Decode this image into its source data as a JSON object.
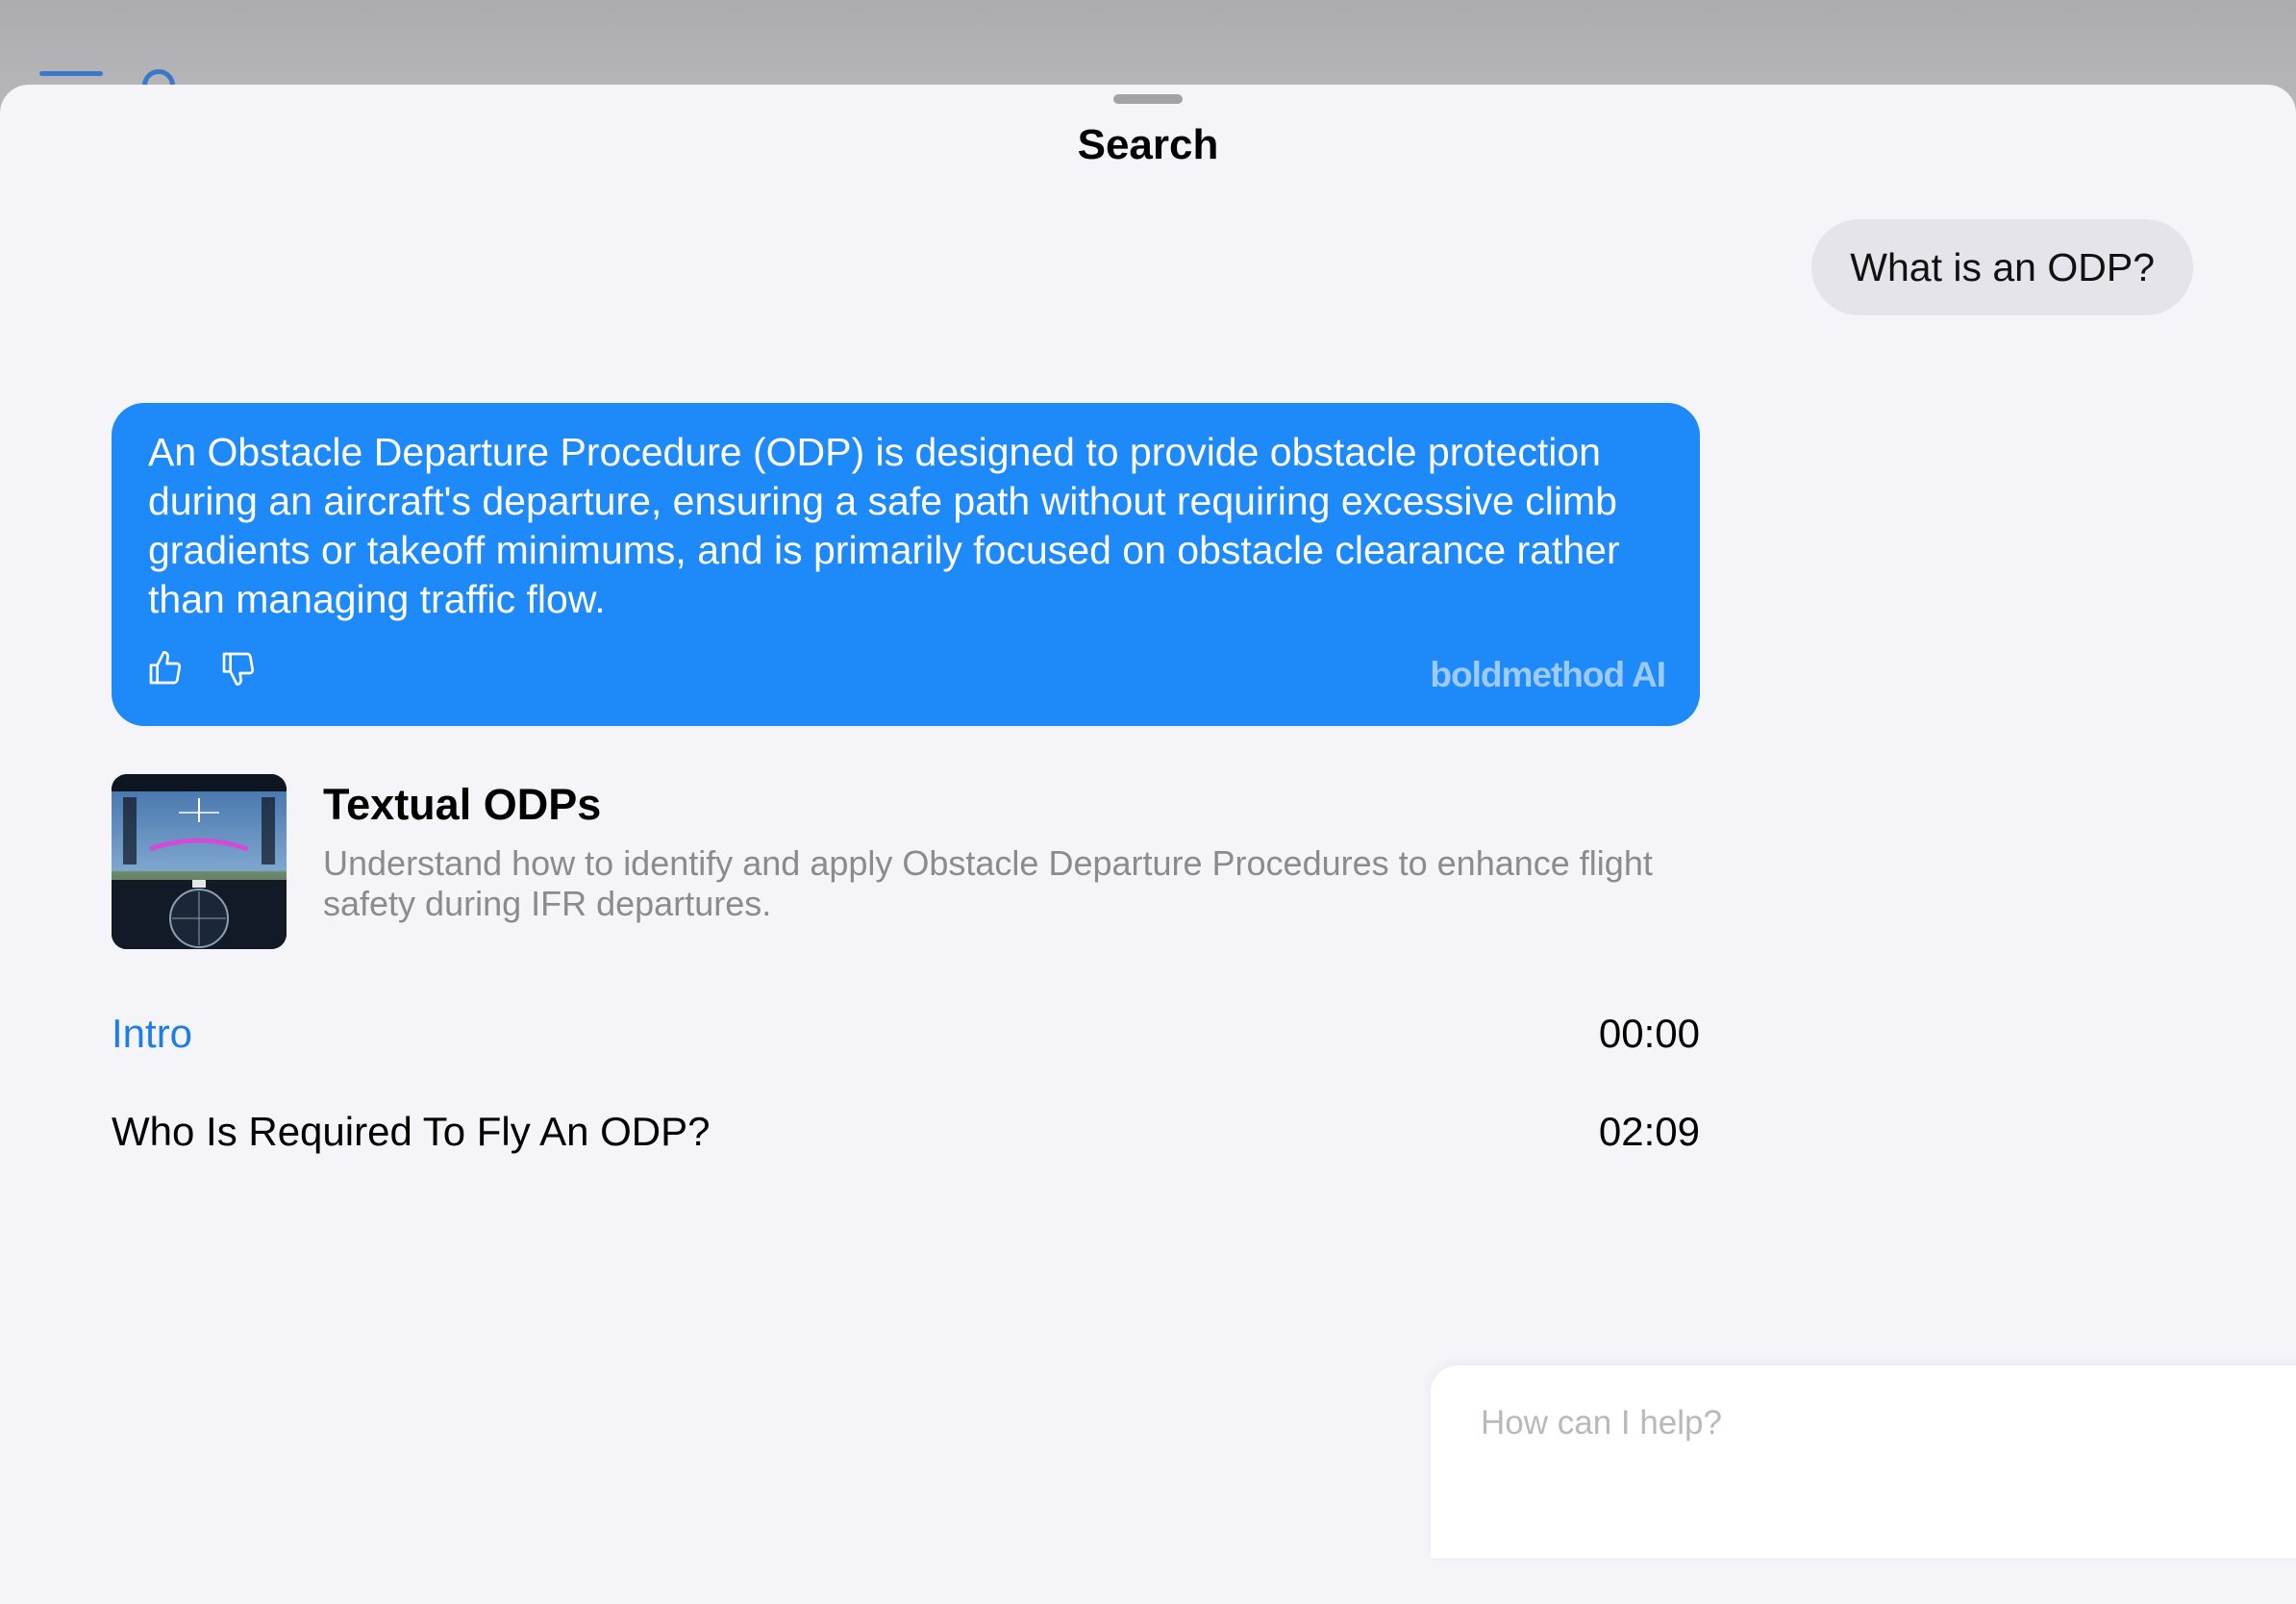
{
  "sheet": {
    "title": "Search"
  },
  "conversation": {
    "user_message": "What is an ODP?",
    "ai_response": "An Obstacle Departure Procedure (ODP) is designed to provide obstacle protection during an aircraft's departure, ensuring a safe path without requiring excessive climb gradients or takeoff minimums, and is primarily focused on obstacle clearance rather than managing traffic flow.",
    "ai_brand": "boldmethod AI",
    "feedback_icons": [
      "thumbs-up-icon",
      "thumbs-down-icon"
    ]
  },
  "lesson": {
    "title": "Textual ODPs",
    "description": "Understand how to identify and apply Obstacle Departure Procedures to enhance flight safety during IFR departures.",
    "chapters": [
      {
        "label": "Intro",
        "time": "00:00"
      },
      {
        "label": "Who Is Required To Fly An ODP?",
        "time": "02:09"
      }
    ]
  },
  "input": {
    "placeholder": "How can I help?",
    "value": ""
  },
  "colors": {
    "accent": "#1e8af9",
    "link": "#1e7ee6",
    "sheet_bg": "#f4f4f9"
  }
}
